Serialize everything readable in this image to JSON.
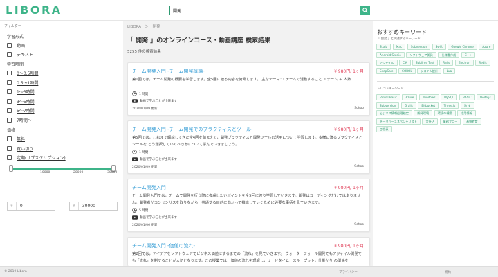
{
  "header": {
    "logo": "LIBORA",
    "search_value": "開発"
  },
  "sidebar": {
    "title": "フィルター",
    "format": {
      "heading": "学習形式",
      "options": [
        "動画",
        "テキスト"
      ]
    },
    "duration": {
      "heading": "学習時間",
      "options": [
        "0～0.5時間",
        "0.5～1時間",
        "1～3時間",
        "3～5時間",
        "5～7時間",
        "7時間～"
      ]
    },
    "pricing": {
      "heading": "価格",
      "options": [
        "無料",
        "買い切り",
        "定期(サブスクリプション)"
      ]
    },
    "slider": {
      "ticks": [
        "10000",
        "20000",
        "30000"
      ],
      "min_fraction": 0,
      "max_fraction": 1
    },
    "price_range": {
      "currency": "¥",
      "min": "0",
      "separator": "—",
      "max": "30000"
    }
  },
  "main": {
    "breadcrumb": "LIBORA　＞　開発",
    "title": "「 開発 」のオンラインコース・動画講座 検索結果",
    "result_count": "5255 件の検索結果",
    "cards": [
      {
        "title": "チーム開発入門 -チーム開発概論-",
        "price": "¥ 980円/ 1ヶ月",
        "desc": "第1回では，チーム開発の概要を学習します。全5回に渡る内容を俯瞰します。 主なテーマ：・チームで活動すること ・チーム ＋ 人数",
        "duration": "1 時間",
        "video": "動画で学ぶことが出来ます",
        "date": "2020/01/09 更新",
        "school": "Schoo"
      },
      {
        "title": "チーム開発入門 -チーム開発でのプラクティスとツール-",
        "price": "¥ 980円/ 1ヶ月",
        "desc": "第5回では，これまで解説してきた全4回を踏まえて，開発プラクティスと開発ツールの活用について学習します。多様に渡るプラクティスとツールを どう選択していくべきかについて学んでいきましょう。",
        "duration": "1 時間",
        "video": "動画で学ぶことが出来ます",
        "date": "2020/01/09 更新",
        "school": "Schoo"
      },
      {
        "title": "チーム開発入門",
        "price": "¥ 980円/ 1ヶ月",
        "desc": "チーム開発入門では，チームで開発を行う際に考慮したいポイントを全5回に渡り学習していきます。開発はコーディングだけではありません。開発者がコンセンサスを取りながら，共通する目的に向かって推進していくために必要な事柄を見ていきます。",
        "duration": "5 時間",
        "video": "動画で学ぶことが出来ます",
        "date": "2020/01/06 更新",
        "school": "Schoo"
      },
      {
        "title": "チーム開発入門 -価値の流れ-",
        "price": "¥ 980円/ 1ヶ月",
        "desc": "第2回では，アイデアをソフトウェアでビジネス価値にするまでの「流れ」を見ていきます。 ウォーターフォール開発でもアジャイル開発でも「流れ」を制することが大切となります。この授業では，価値の流れを理解し，リードタイム，スループット，仕掛かり の関係を"
      }
    ]
  },
  "rightbar": {
    "title": "おすすめキーワード",
    "subtitle": "「 開発 」と関連するキーワード",
    "keywords": [
      "Scala",
      "Mac",
      "Subversion",
      "Swift",
      "Google Chrome",
      "Azure",
      "Android Studio",
      "ソフトウェア開発",
      "仕様書作成",
      "C++",
      "アジャイル",
      "C#",
      "Sublime Text",
      "Rails",
      "Electron",
      "Redis",
      "SnapSale",
      "COBOL",
      "システム設計",
      "Lua"
    ],
    "trend_subtitle": "トレンドキーワード",
    "trend_keywords": [
      "Visual Basic",
      "Azure",
      "Windows",
      "MySQL",
      "BASIC",
      "Node.js",
      "Subversion",
      "Grails",
      "Bitbucket",
      "Three.js",
      "流 す",
      "ビジネス情報処理検定",
      "開発環境",
      "環境の構築",
      "応用情報",
      "データベーススペシャリスト",
      "言仕込",
      "業務フロー",
      "基盤教育",
      "工程表"
    ]
  },
  "footer": {
    "copyright": "© 2019 Libora",
    "privacy": "プライバシー",
    "terms": "規約"
  },
  "colors": {
    "brand": "#3eb489",
    "link": "#3a9fd6",
    "price": "#e0405a"
  }
}
